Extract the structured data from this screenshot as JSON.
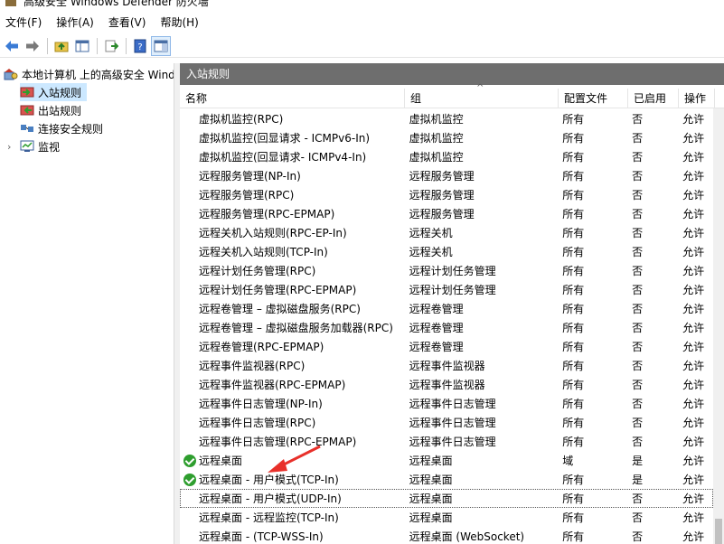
{
  "window": {
    "title": "高级安全 Windows Defender 防火墙"
  },
  "menu": [
    {
      "label": "文件(F)"
    },
    {
      "label": "操作(A)"
    },
    {
      "label": "查看(V)"
    },
    {
      "label": "帮助(H)"
    }
  ],
  "tree": {
    "root": "本地计算机 上的高级安全 Windows Defender 防火墙",
    "items": [
      {
        "label": "入站规则"
      },
      {
        "label": "出站规则"
      },
      {
        "label": "连接安全规则"
      },
      {
        "label": "监视"
      }
    ]
  },
  "pane_title": "入站规则",
  "columns": {
    "name": "名称",
    "group": "组",
    "profile": "配置文件",
    "enabled": "已启用",
    "action": "操作"
  },
  "rules": [
    {
      "name": "虚拟机监控(RPC)",
      "group": "虚拟机监控",
      "profile": "所有",
      "enabled": "否",
      "action": "允许",
      "on": false
    },
    {
      "name": "虚拟机监控(回显请求 - ICMPv6-In)",
      "group": "虚拟机监控",
      "profile": "所有",
      "enabled": "否",
      "action": "允许",
      "on": false
    },
    {
      "name": "虚拟机监控(回显请求- ICMPv4-In)",
      "group": "虚拟机监控",
      "profile": "所有",
      "enabled": "否",
      "action": "允许",
      "on": false
    },
    {
      "name": "远程服务管理(NP-In)",
      "group": "远程服务管理",
      "profile": "所有",
      "enabled": "否",
      "action": "允许",
      "on": false
    },
    {
      "name": "远程服务管理(RPC)",
      "group": "远程服务管理",
      "profile": "所有",
      "enabled": "否",
      "action": "允许",
      "on": false
    },
    {
      "name": "远程服务管理(RPC-EPMAP)",
      "group": "远程服务管理",
      "profile": "所有",
      "enabled": "否",
      "action": "允许",
      "on": false
    },
    {
      "name": "远程关机入站规则(RPC-EP-In)",
      "group": "远程关机",
      "profile": "所有",
      "enabled": "否",
      "action": "允许",
      "on": false
    },
    {
      "name": "远程关机入站规则(TCP-In)",
      "group": "远程关机",
      "profile": "所有",
      "enabled": "否",
      "action": "允许",
      "on": false
    },
    {
      "name": "远程计划任务管理(RPC)",
      "group": "远程计划任务管理",
      "profile": "所有",
      "enabled": "否",
      "action": "允许",
      "on": false
    },
    {
      "name": "远程计划任务管理(RPC-EPMAP)",
      "group": "远程计划任务管理",
      "profile": "所有",
      "enabled": "否",
      "action": "允许",
      "on": false
    },
    {
      "name": "远程卷管理 – 虚拟磁盘服务(RPC)",
      "group": "远程卷管理",
      "profile": "所有",
      "enabled": "否",
      "action": "允许",
      "on": false
    },
    {
      "name": "远程卷管理 – 虚拟磁盘服务加载器(RPC)",
      "group": "远程卷管理",
      "profile": "所有",
      "enabled": "否",
      "action": "允许",
      "on": false
    },
    {
      "name": "远程卷管理(RPC-EPMAP)",
      "group": "远程卷管理",
      "profile": "所有",
      "enabled": "否",
      "action": "允许",
      "on": false
    },
    {
      "name": "远程事件监视器(RPC)",
      "group": "远程事件监视器",
      "profile": "所有",
      "enabled": "否",
      "action": "允许",
      "on": false
    },
    {
      "name": "远程事件监视器(RPC-EPMAP)",
      "group": "远程事件监视器",
      "profile": "所有",
      "enabled": "否",
      "action": "允许",
      "on": false
    },
    {
      "name": "远程事件日志管理(NP-In)",
      "group": "远程事件日志管理",
      "profile": "所有",
      "enabled": "否",
      "action": "允许",
      "on": false
    },
    {
      "name": "远程事件日志管理(RPC)",
      "group": "远程事件日志管理",
      "profile": "所有",
      "enabled": "否",
      "action": "允许",
      "on": false
    },
    {
      "name": "远程事件日志管理(RPC-EPMAP)",
      "group": "远程事件日志管理",
      "profile": "所有",
      "enabled": "否",
      "action": "允许",
      "on": false
    },
    {
      "name": "远程桌面",
      "group": "远程桌面",
      "profile": "域",
      "enabled": "是",
      "action": "允许",
      "on": true
    },
    {
      "name": "远程桌面 - 用户模式(TCP-In)",
      "group": "远程桌面",
      "profile": "所有",
      "enabled": "是",
      "action": "允许",
      "on": true
    },
    {
      "name": "远程桌面 - 用户模式(UDP-In)",
      "group": "远程桌面",
      "profile": "所有",
      "enabled": "否",
      "action": "允许",
      "on": false
    },
    {
      "name": "远程桌面 - 远程监控(TCP-In)",
      "group": "远程桌面",
      "profile": "所有",
      "enabled": "否",
      "action": "允许",
      "on": false
    },
    {
      "name": "远程桌面 - (TCP-WSS-In)",
      "group": "远程桌面 (WebSocket)",
      "profile": "所有",
      "enabled": "否",
      "action": "允许",
      "on": false
    }
  ],
  "colors": {
    "accent_selected": "#cce8ff",
    "pane_title_bg": "#6e6e6e",
    "enabled_icon": "#2e9e2e",
    "annotation_arrow": "#e8302a"
  }
}
